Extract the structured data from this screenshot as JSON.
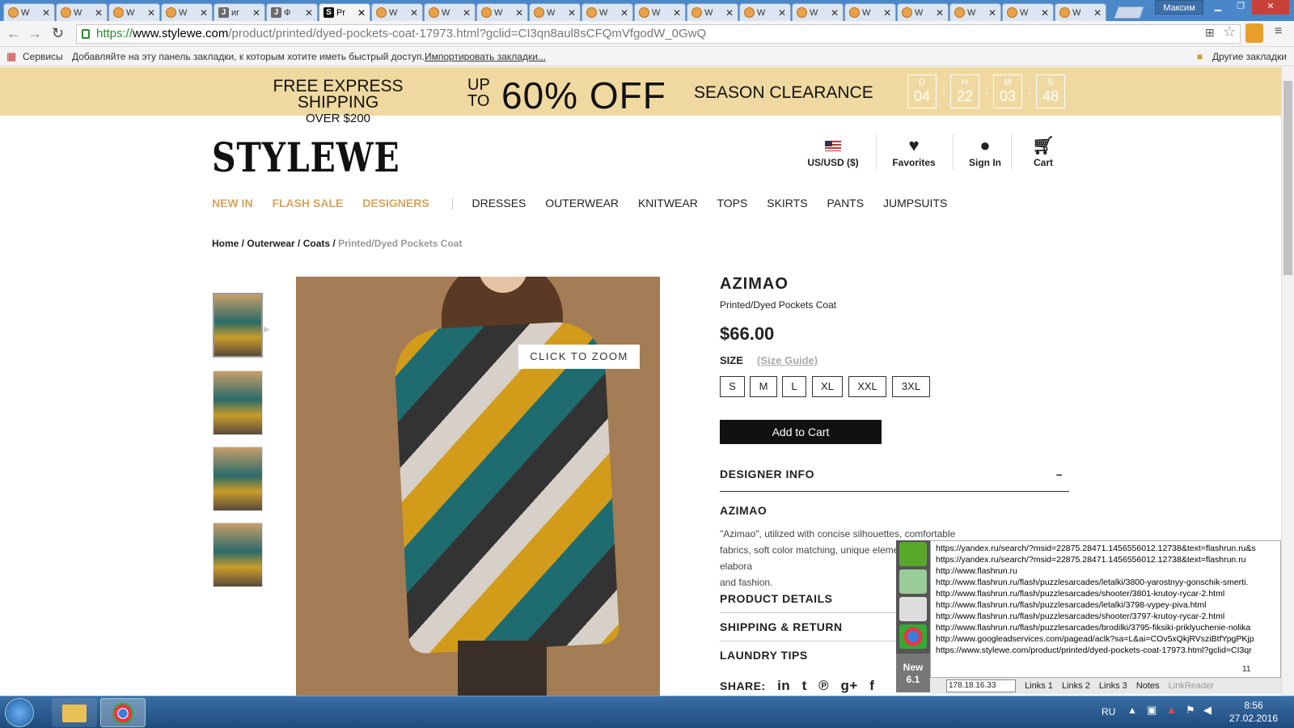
{
  "browser": {
    "tabs": [
      {
        "title": "W"
      },
      {
        "title": "W"
      },
      {
        "title": "W"
      },
      {
        "title": "W"
      },
      {
        "title": "иг",
        "icon": "J"
      },
      {
        "title": "Ф",
        "icon": "J"
      },
      {
        "title": "Pr",
        "icon": "S",
        "active": true
      },
      {
        "title": "W"
      },
      {
        "title": "W"
      },
      {
        "title": "W"
      },
      {
        "title": "W"
      },
      {
        "title": "W"
      },
      {
        "title": "W"
      },
      {
        "title": "W"
      },
      {
        "title": "W"
      },
      {
        "title": "W"
      },
      {
        "title": "W"
      },
      {
        "title": "W"
      },
      {
        "title": "W"
      },
      {
        "title": "W"
      },
      {
        "title": "W"
      }
    ],
    "tab_close": "✕",
    "user": "Максим",
    "url": {
      "proto": "https://",
      "host": "www.stylewe.com",
      "path": "/product/printed/dyed-pockets-coat-17973.html?gclid=CI3qn8aul8sCFQmVfgodW_0GwQ"
    },
    "bookmarks": {
      "apps": "Сервисы",
      "hint": "Добавляйте на эту панель закладки, к которым хотите иметь быстрый доступ.",
      "import": "Импортировать закладки...",
      "other": "Другие закладки"
    }
  },
  "promo": {
    "line1": "FREE EXPRESS SHIPPING",
    "line2": "OVER $200",
    "up": "UP",
    "to": "TO",
    "big": "60% OFF",
    "season": "SEASON CLEARANCE",
    "countdown": [
      {
        "label": "D",
        "value": "04"
      },
      {
        "label": "H",
        "value": "22"
      },
      {
        "label": "M",
        "value": "03"
      },
      {
        "label": "S",
        "value": "48"
      }
    ],
    "sep": ":"
  },
  "header": {
    "logo": "STYLEWE",
    "currency": "US/USD ($)",
    "favorites": "Favorites",
    "signin": "Sign In",
    "cart": "Cart"
  },
  "nav": {
    "highlight": [
      "NEW IN",
      "FLASH SALE",
      "DESIGNERS"
    ],
    "items": [
      "DRESSES",
      "OUTERWEAR",
      "KNITWEAR",
      "TOPS",
      "SKIRTS",
      "PANTS",
      "JUMPSUITS"
    ]
  },
  "breadcrumb": {
    "home": "Home",
    "outerwear": "Outerwear",
    "coats": "Coats",
    "current": "Printed/Dyed Pockets Coat",
    "sep": " / "
  },
  "product": {
    "zoom_label": "CLICK TO ZOOM",
    "brand": "AZIMAO",
    "name": "Printed/Dyed Pockets Coat",
    "price": "$66.00",
    "size_label": "SIZE",
    "size_guide": "(Size Guide)",
    "sizes": [
      "S",
      "M",
      "L",
      "XL",
      "XXL",
      "3XL"
    ],
    "add_to_cart": "Add to Cart",
    "designer_info": "DESIGNER INFO",
    "designer_toggle": "–",
    "designer_heading": "AZIMAO",
    "designer_desc": "\"Azimao\", utilized with concise silhouettes, comfortable fabrics, soft color matching, unique elements and elabora",
    "designer_desc2": "and fashion.",
    "product_details": "PRODUCT DETAILS",
    "shipping": "SHIPPING & RETURN",
    "laundry": "LAUNDRY TIPS",
    "share": "SHARE:"
  },
  "links_panel": {
    "items": [
      "https://yandex.ru/search/?msid=22875.28471.1456556012.12738&text=flashrun.ru&s",
      "https://yandex.ru/search/?msid=22875.28471.1456556012.12738&text=flashrun.ru",
      "http://www.flashrun.ru",
      "http://www.flashrun.ru/flash/puzzlesarcades/letalki/3800-yarostnyy-gonschik-smerti.",
      "http://www.flashrun.ru/flash/puzzlesarcades/shooter/3801-krutoy-rycar-2.html",
      "http://www.flashrun.ru/flash/puzzlesarcades/letalki/3798-vypey-piva.html",
      "http://www.flashrun.ru/flash/puzzlesarcades/shooter/3797-krutoy-rycar-2.html",
      "http://www.flashrun.ru/flash/puzzlesarcades/brodilki/3795-fiksiki-priklyuchenie-nolika",
      "http://www.googleadservices.com/pagead/aclk?sa=L&ai=COv5xQkjRVsziBtfYpgPKjp",
      "https://www.stylewe.com/product/printed/dyed-pockets-coat-17973.html?gclid=CI3qr"
    ],
    "count": "11",
    "new_badge_1": "New",
    "new_badge_2": "6.1",
    "ip": "178.18.16.33",
    "tabs": [
      "Links 1",
      "Links 2",
      "Links 3",
      "Notes",
      "LinkReader"
    ]
  },
  "taskbar": {
    "lang": "RU",
    "time": "8:56",
    "date": "27.02.2016"
  }
}
